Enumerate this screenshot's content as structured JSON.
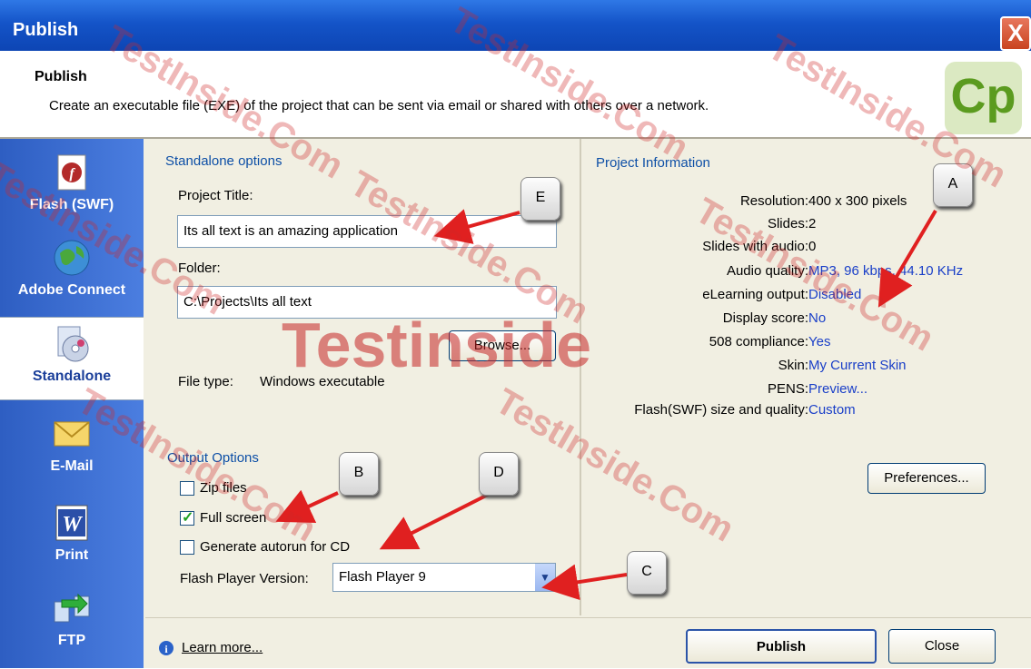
{
  "window": {
    "title": "Publish",
    "close_glyph": "X"
  },
  "header": {
    "title": "Publish",
    "description": "Create an executable file (EXE) of the project that can be sent via email or shared with others over a network.",
    "logo_text": "Cp"
  },
  "sidebar": {
    "items": [
      {
        "label": "Flash (SWF)",
        "icon": "flash-icon",
        "selected": false
      },
      {
        "label": "Adobe Connect",
        "icon": "globe-icon",
        "selected": false
      },
      {
        "label": "Standalone",
        "icon": "cd-icon",
        "selected": true
      },
      {
        "label": "E-Mail",
        "icon": "envelope-icon",
        "selected": false
      },
      {
        "label": "Print",
        "icon": "word-icon",
        "selected": false
      },
      {
        "label": "FTP",
        "icon": "ftp-icon",
        "selected": false
      }
    ]
  },
  "standalone": {
    "group_label": "Standalone options",
    "project_title_label": "Project Title:",
    "project_title_value": "Its all text is an amazing application",
    "folder_label": "Folder:",
    "folder_value": "C:\\Projects\\Its all text",
    "browse_label": "Browse...",
    "file_type_label": "File type:",
    "file_type_value": "Windows executable"
  },
  "output": {
    "group_label": "Output Options",
    "zip_label": "Zip files",
    "zip_checked": false,
    "fullscreen_label": "Full screen",
    "fullscreen_checked": true,
    "autorun_label": "Generate autorun for CD",
    "autorun_checked": false,
    "player_label": "Flash Player Version:",
    "player_value": "Flash Player 9"
  },
  "project_info": {
    "group_label": "Project Information",
    "rows": [
      {
        "key": "Resolution:",
        "value": "400 x 300 pixels",
        "link": false
      },
      {
        "key": "Slides:",
        "value": "2",
        "link": false
      },
      {
        "key": "Slides with audio:",
        "value": "0",
        "link": false
      },
      {
        "key": "Audio quality:",
        "value": "MP3, 96 kbps, 44.10 KHz",
        "link": true
      },
      {
        "key": "eLearning output:",
        "value": "Disabled",
        "link": true
      },
      {
        "key": "Display score:",
        "value": "No",
        "link": true
      },
      {
        "key": "508 compliance:",
        "value": "Yes",
        "link": true
      },
      {
        "key": "Skin:",
        "value": "My Current Skin",
        "link": true
      },
      {
        "key": "PENS:",
        "value": "Preview...",
        "link": true
      },
      {
        "key": "Flash(SWF) size and quality:",
        "value": "Custom",
        "link": true
      }
    ],
    "preferences_label": "Preferences..."
  },
  "footer": {
    "learn_more": "Learn more...",
    "publish_label": "Publish",
    "close_label": "Close"
  },
  "callouts": [
    "A",
    "B",
    "C",
    "D",
    "E"
  ],
  "watermark": {
    "big": "Testinside",
    "small": "TestInside.Com"
  },
  "colors": {
    "title_bar": "#1454c8",
    "sidebar": "#3a6fd6",
    "link": "#1a3fc8",
    "arrow": "#e02020",
    "watermark": "#ce2828"
  }
}
